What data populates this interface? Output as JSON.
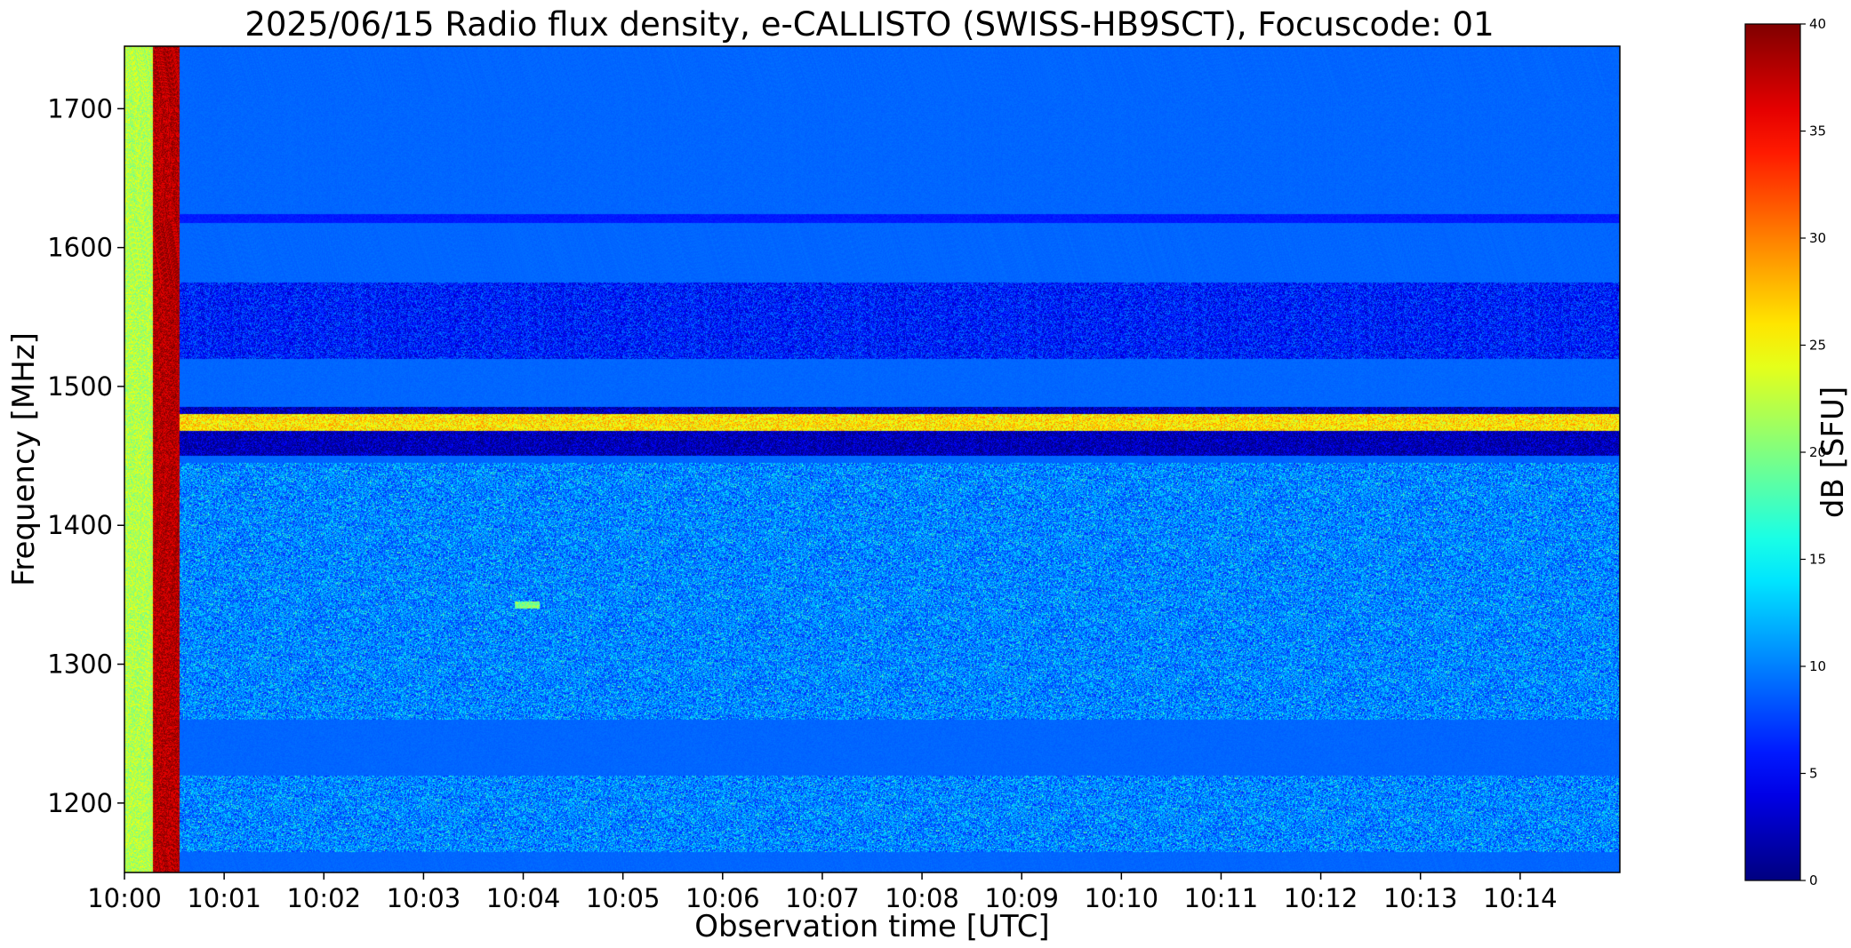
{
  "chart_data": {
    "type": "heatmap",
    "title": "2025/06/15  Radio flux density, e-CALLISTO (SWISS-HB9SCT), Focuscode: 01",
    "xlabel": "Observation time [UTC]",
    "ylabel": "Frequency [MHz]",
    "colorbar_label": "dB [SFU]",
    "colormap": "jet",
    "xlim": [
      "10:00:00",
      "10:15:00"
    ],
    "ylim": [
      1150,
      1745
    ],
    "clim": [
      0,
      40
    ],
    "x_ticks": [
      "10:00",
      "10:01",
      "10:02",
      "10:03",
      "10:04",
      "10:05",
      "10:06",
      "10:07",
      "10:08",
      "10:09",
      "10:10",
      "10:11",
      "10:12",
      "10:13",
      "10:14"
    ],
    "y_ticks": [
      1200,
      1300,
      1400,
      1500,
      1600,
      1700
    ],
    "colorbar_ticks": [
      0,
      5,
      10,
      15,
      20,
      25,
      30,
      35,
      40
    ],
    "background_level_db": 9,
    "features": [
      {
        "kind": "calibration",
        "t_start": "10:00:00",
        "t_end": "10:00:17",
        "f_min": 1150,
        "f_max": 1745,
        "level_db": 22
      },
      {
        "kind": "calibration",
        "t_start": "10:00:17",
        "t_end": "10:00:33",
        "f_min": 1150,
        "f_max": 1745,
        "level_db": 38
      },
      {
        "kind": "interference_band",
        "t_start": "10:00:33",
        "t_end": "10:15:00",
        "f_min": 1450,
        "f_max": 1485,
        "level_db": 2
      },
      {
        "kind": "interference_band",
        "t_start": "10:00:33",
        "t_end": "10:15:00",
        "f_min": 1468,
        "f_max": 1480,
        "level_db": 26
      },
      {
        "kind": "interference_band",
        "t_start": "10:00:33",
        "t_end": "10:15:00",
        "f_min": 1520,
        "f_max": 1575,
        "level_db": 6
      },
      {
        "kind": "noise_region",
        "t_start": "10:00:33",
        "t_end": "10:15:00",
        "f_min": 1165,
        "f_max": 1445,
        "level_db": 10
      },
      {
        "kind": "quiet_band",
        "t_start": "10:00:33",
        "t_end": "10:15:00",
        "f_min": 1220,
        "f_max": 1260,
        "level_db": 9
      },
      {
        "kind": "quiet_band",
        "t_start": "10:00:33",
        "t_end": "10:15:00",
        "f_min": 1485,
        "f_max": 1520,
        "level_db": 9
      },
      {
        "kind": "quiet_band",
        "t_start": "10:00:33",
        "t_end": "10:15:00",
        "f_min": 1630,
        "f_max": 1710,
        "level_db": 9
      },
      {
        "kind": "line",
        "t_start": "10:00:33",
        "t_end": "10:15:00",
        "f_min": 1618,
        "f_max": 1624,
        "level_db": 6
      },
      {
        "kind": "burst",
        "t_start": "10:03:55",
        "t_end": "10:04:10",
        "f_min": 1340,
        "f_max": 1345,
        "level_db": 20
      }
    ]
  }
}
